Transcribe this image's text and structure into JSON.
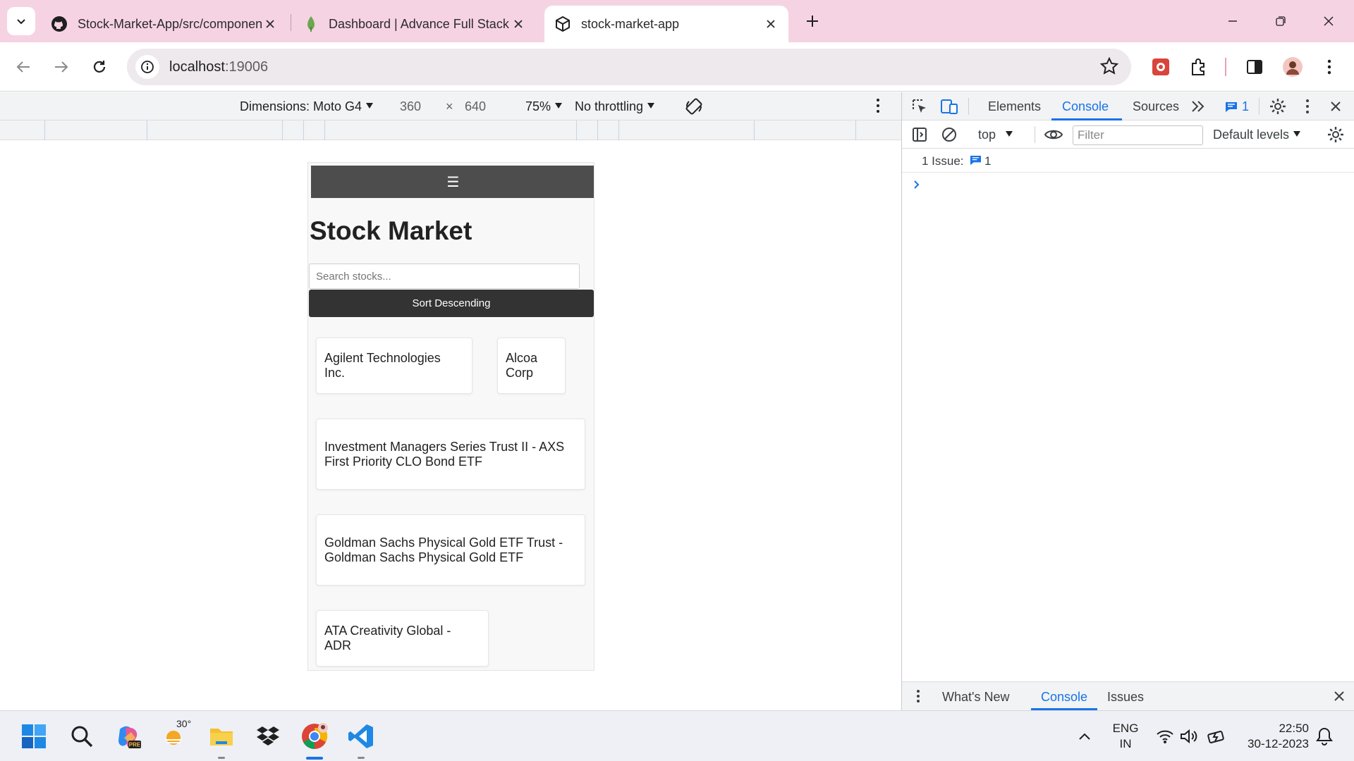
{
  "browser": {
    "tabs": [
      {
        "title": "Stock-Market-App/src/components",
        "icon": "github-icon",
        "active": false
      },
      {
        "title": "Dashboard | Advance Full Stack",
        "icon": "mongodb-leaf-icon",
        "active": false
      },
      {
        "title": "stock-market-app",
        "icon": "codesandbox-icon",
        "active": true
      }
    ],
    "url_host": "localhost",
    "url_port": ":19006"
  },
  "device_toolbar": {
    "dimensions": "Dimensions: Moto G4",
    "width": "360",
    "times": "×",
    "height": "640",
    "zoom": "75%",
    "throttling": "No throttling"
  },
  "app": {
    "menu_icon": "☰",
    "title": "Stock Market",
    "search_placeholder": "Search stocks...",
    "sort_button": "Sort Descending",
    "stocks": [
      "Agilent Technologies Inc.",
      "Alcoa Corp",
      "Investment Managers Series Trust II - AXS First Priority CLO Bond ETF",
      "Goldman Sachs Physical Gold ETF Trust - Goldman Sachs Physical Gold ETF",
      "ATA Creativity Global - ADR"
    ]
  },
  "devtools": {
    "tabs": [
      "Elements",
      "Console",
      "Sources"
    ],
    "active_tab": "Console",
    "issues_badge": "1",
    "context": "top",
    "filter_placeholder": "Filter",
    "levels": "Default levels",
    "issues_label": "1 Issue:",
    "issues_count": "1",
    "drawer_tabs": [
      "What's New",
      "Console",
      "Issues"
    ]
  },
  "taskbar": {
    "weather_temp": "30°",
    "lang_top": "ENG",
    "lang_bottom": "IN",
    "time": "22:50",
    "date": "30-12-2023"
  },
  "colors": {
    "tabstrip": "#f6d3e3",
    "accent": "#1a73e8",
    "app_navbar": "#4d4d4d",
    "sort_button": "#333333"
  }
}
